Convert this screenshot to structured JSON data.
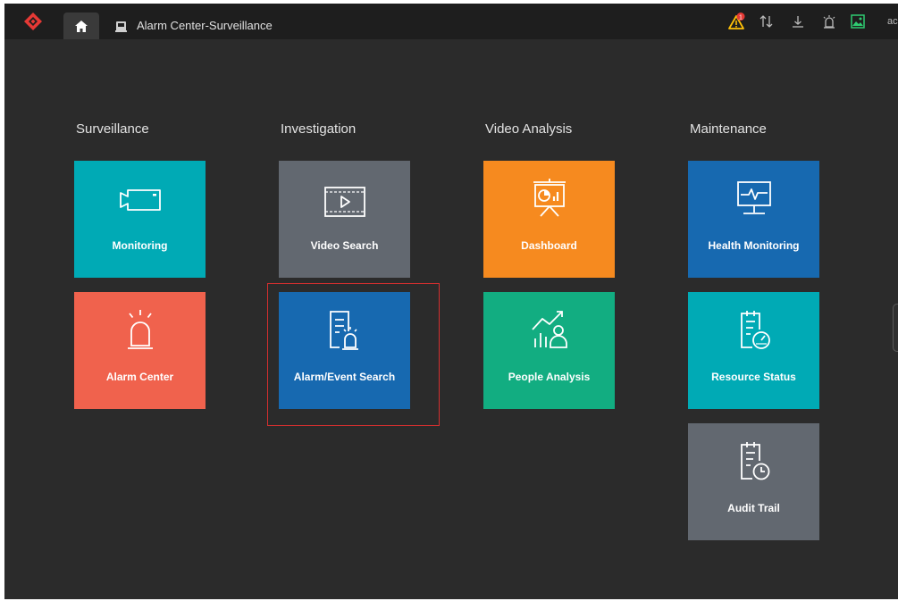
{
  "header": {
    "tab_title": "Alarm Center-Surveillance",
    "user_text": "ac",
    "alarm_badge_count": "1",
    "icons": [
      "logo-icon",
      "home-icon",
      "alarm-center-tab-icon",
      "alarm-warning-icon",
      "transfer-icon",
      "download-icon",
      "alarm-light-icon",
      "image-icon"
    ]
  },
  "columns": [
    {
      "title": "Surveillance",
      "tiles": [
        {
          "label": "Monitoring",
          "color": "#00aab5",
          "icon": "camera-icon"
        },
        {
          "label": "Alarm Center",
          "color": "#f0624d",
          "icon": "alarm-light-icon"
        }
      ]
    },
    {
      "title": "Investigation",
      "tiles": [
        {
          "label": "Video Search",
          "color": "#626870",
          "icon": "video-player-icon"
        },
        {
          "label": "Alarm/Event Search",
          "color": "#1769b0",
          "icon": "alarm-document-icon"
        }
      ]
    },
    {
      "title": "Video Analysis",
      "tiles": [
        {
          "label": "Dashboard",
          "color": "#f68a1f",
          "icon": "dashboard-board-icon"
        },
        {
          "label": "People Analysis",
          "color": "#12ad81",
          "icon": "people-chart-icon"
        }
      ]
    },
    {
      "title": "Maintenance",
      "tiles": [
        {
          "label": "Health Monitoring",
          "color": "#1769b0",
          "icon": "health-monitor-icon"
        },
        {
          "label": "Resource Status",
          "color": "#00aab5",
          "icon": "resource-gauge-icon"
        },
        {
          "label": "Audit Trail",
          "color": "#626870",
          "icon": "audit-clock-icon"
        }
      ]
    }
  ],
  "selected_tile": "Alarm/Event Search",
  "colors": {
    "background": "#2b2b2b",
    "topbar": "#1e1e1e",
    "selection_border": "#d32f2f",
    "logo": "#e53935",
    "warning": "#ffc107",
    "image_icon": "#2ecc71"
  }
}
